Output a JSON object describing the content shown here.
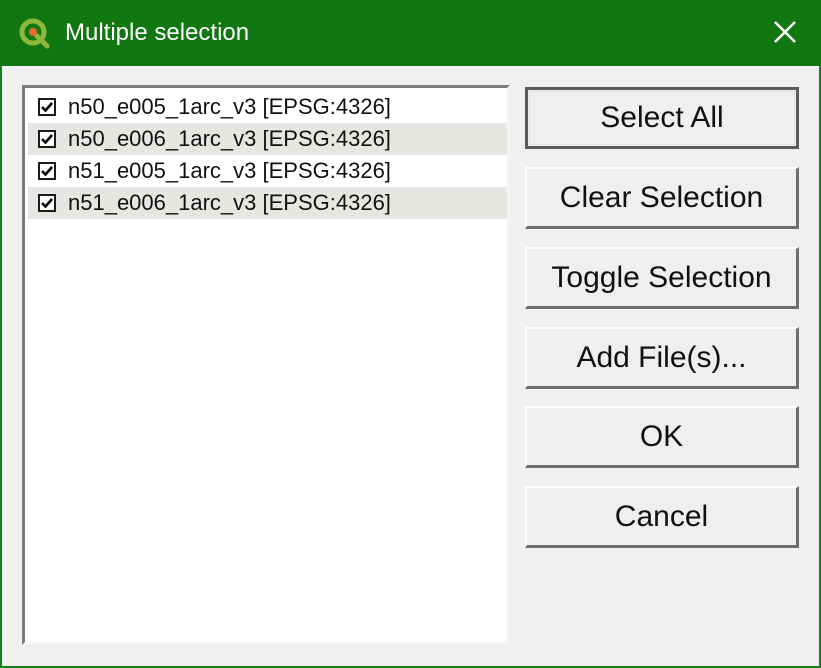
{
  "window": {
    "title": "Multiple selection",
    "title_bar_color": "#117711",
    "app_icon": "qgis-logo-icon",
    "close_icon": "close-icon"
  },
  "list": {
    "items": [
      {
        "label": "n50_e005_1arc_v3 [EPSG:4326]",
        "checked": true
      },
      {
        "label": "n50_e006_1arc_v3 [EPSG:4326]",
        "checked": true
      },
      {
        "label": "n51_e005_1arc_v3 [EPSG:4326]",
        "checked": true
      },
      {
        "label": "n51_e006_1arc_v3 [EPSG:4326]",
        "checked": true
      }
    ]
  },
  "buttons": {
    "select_all": "Select All",
    "clear_selection": "Clear Selection",
    "toggle_selection": "Toggle Selection",
    "add_files": "Add File(s)...",
    "ok": "OK",
    "cancel": "Cancel"
  }
}
